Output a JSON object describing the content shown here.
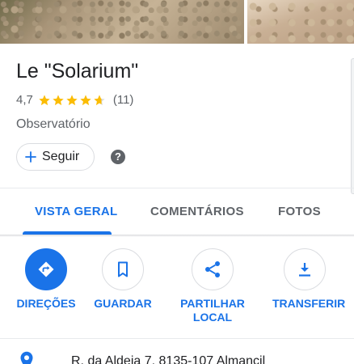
{
  "place": {
    "name": "Le \"Solarium\"",
    "rating": "4,7",
    "stars": 4.7,
    "reviews_count": "(11)",
    "category": "Observatório",
    "follow_label": "Seguir",
    "help_icon": "?"
  },
  "tabs": [
    {
      "label": "VISTA GERAL",
      "active": true
    },
    {
      "label": "COMENTÁRIOS",
      "active": false
    },
    {
      "label": "FOTOS",
      "active": false
    }
  ],
  "actions": [
    {
      "label": "DIREÇÕES",
      "icon": "directions-icon"
    },
    {
      "label": "GUARDAR",
      "icon": "bookmark-icon"
    },
    {
      "label": "PARTILHAR LOCAL",
      "icon": "share-icon"
    },
    {
      "label": "TRANSFERIR",
      "icon": "download-icon"
    }
  ],
  "address": {
    "text": "R. da Aldeia 7, 8135-107 Almancil",
    "icon": "location-pin-icon"
  },
  "colors": {
    "accent": "#1a73e8",
    "star": "#fbbc04",
    "text_secondary": "#5f6368"
  }
}
